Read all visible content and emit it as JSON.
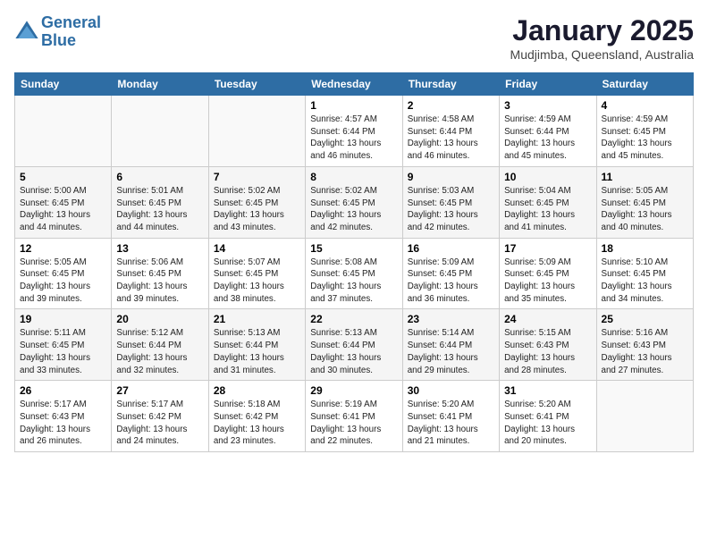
{
  "header": {
    "logo_line1": "General",
    "logo_line2": "Blue",
    "month": "January 2025",
    "location": "Mudjimba, Queensland, Australia"
  },
  "weekdays": [
    "Sunday",
    "Monday",
    "Tuesday",
    "Wednesday",
    "Thursday",
    "Friday",
    "Saturday"
  ],
  "weeks": [
    [
      {
        "day": "",
        "info": ""
      },
      {
        "day": "",
        "info": ""
      },
      {
        "day": "",
        "info": ""
      },
      {
        "day": "1",
        "info": "Sunrise: 4:57 AM\nSunset: 6:44 PM\nDaylight: 13 hours\nand 46 minutes."
      },
      {
        "day": "2",
        "info": "Sunrise: 4:58 AM\nSunset: 6:44 PM\nDaylight: 13 hours\nand 46 minutes."
      },
      {
        "day": "3",
        "info": "Sunrise: 4:59 AM\nSunset: 6:44 PM\nDaylight: 13 hours\nand 45 minutes."
      },
      {
        "day": "4",
        "info": "Sunrise: 4:59 AM\nSunset: 6:45 PM\nDaylight: 13 hours\nand 45 minutes."
      }
    ],
    [
      {
        "day": "5",
        "info": "Sunrise: 5:00 AM\nSunset: 6:45 PM\nDaylight: 13 hours\nand 44 minutes."
      },
      {
        "day": "6",
        "info": "Sunrise: 5:01 AM\nSunset: 6:45 PM\nDaylight: 13 hours\nand 44 minutes."
      },
      {
        "day": "7",
        "info": "Sunrise: 5:02 AM\nSunset: 6:45 PM\nDaylight: 13 hours\nand 43 minutes."
      },
      {
        "day": "8",
        "info": "Sunrise: 5:02 AM\nSunset: 6:45 PM\nDaylight: 13 hours\nand 42 minutes."
      },
      {
        "day": "9",
        "info": "Sunrise: 5:03 AM\nSunset: 6:45 PM\nDaylight: 13 hours\nand 42 minutes."
      },
      {
        "day": "10",
        "info": "Sunrise: 5:04 AM\nSunset: 6:45 PM\nDaylight: 13 hours\nand 41 minutes."
      },
      {
        "day": "11",
        "info": "Sunrise: 5:05 AM\nSunset: 6:45 PM\nDaylight: 13 hours\nand 40 minutes."
      }
    ],
    [
      {
        "day": "12",
        "info": "Sunrise: 5:05 AM\nSunset: 6:45 PM\nDaylight: 13 hours\nand 39 minutes."
      },
      {
        "day": "13",
        "info": "Sunrise: 5:06 AM\nSunset: 6:45 PM\nDaylight: 13 hours\nand 39 minutes."
      },
      {
        "day": "14",
        "info": "Sunrise: 5:07 AM\nSunset: 6:45 PM\nDaylight: 13 hours\nand 38 minutes."
      },
      {
        "day": "15",
        "info": "Sunrise: 5:08 AM\nSunset: 6:45 PM\nDaylight: 13 hours\nand 37 minutes."
      },
      {
        "day": "16",
        "info": "Sunrise: 5:09 AM\nSunset: 6:45 PM\nDaylight: 13 hours\nand 36 minutes."
      },
      {
        "day": "17",
        "info": "Sunrise: 5:09 AM\nSunset: 6:45 PM\nDaylight: 13 hours\nand 35 minutes."
      },
      {
        "day": "18",
        "info": "Sunrise: 5:10 AM\nSunset: 6:45 PM\nDaylight: 13 hours\nand 34 minutes."
      }
    ],
    [
      {
        "day": "19",
        "info": "Sunrise: 5:11 AM\nSunset: 6:45 PM\nDaylight: 13 hours\nand 33 minutes."
      },
      {
        "day": "20",
        "info": "Sunrise: 5:12 AM\nSunset: 6:44 PM\nDaylight: 13 hours\nand 32 minutes."
      },
      {
        "day": "21",
        "info": "Sunrise: 5:13 AM\nSunset: 6:44 PM\nDaylight: 13 hours\nand 31 minutes."
      },
      {
        "day": "22",
        "info": "Sunrise: 5:13 AM\nSunset: 6:44 PM\nDaylight: 13 hours\nand 30 minutes."
      },
      {
        "day": "23",
        "info": "Sunrise: 5:14 AM\nSunset: 6:44 PM\nDaylight: 13 hours\nand 29 minutes."
      },
      {
        "day": "24",
        "info": "Sunrise: 5:15 AM\nSunset: 6:43 PM\nDaylight: 13 hours\nand 28 minutes."
      },
      {
        "day": "25",
        "info": "Sunrise: 5:16 AM\nSunset: 6:43 PM\nDaylight: 13 hours\nand 27 minutes."
      }
    ],
    [
      {
        "day": "26",
        "info": "Sunrise: 5:17 AM\nSunset: 6:43 PM\nDaylight: 13 hours\nand 26 minutes."
      },
      {
        "day": "27",
        "info": "Sunrise: 5:17 AM\nSunset: 6:42 PM\nDaylight: 13 hours\nand 24 minutes."
      },
      {
        "day": "28",
        "info": "Sunrise: 5:18 AM\nSunset: 6:42 PM\nDaylight: 13 hours\nand 23 minutes."
      },
      {
        "day": "29",
        "info": "Sunrise: 5:19 AM\nSunset: 6:41 PM\nDaylight: 13 hours\nand 22 minutes."
      },
      {
        "day": "30",
        "info": "Sunrise: 5:20 AM\nSunset: 6:41 PM\nDaylight: 13 hours\nand 21 minutes."
      },
      {
        "day": "31",
        "info": "Sunrise: 5:20 AM\nSunset: 6:41 PM\nDaylight: 13 hours\nand 20 minutes."
      },
      {
        "day": "",
        "info": ""
      }
    ]
  ]
}
